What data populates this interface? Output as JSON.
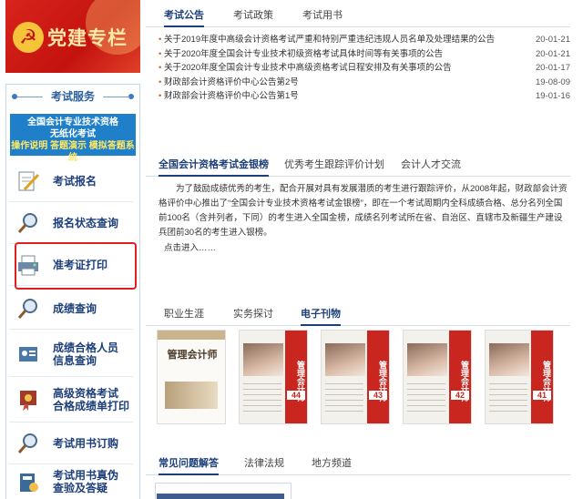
{
  "left": {
    "party_title": "党建专栏",
    "service_title": "考试服务",
    "banner": {
      "line1": "全国会计专业技术资格",
      "line2": "无纸化考试",
      "line3": "操作说明 答题演示 模拟答题系统"
    },
    "items": [
      {
        "label": "考试报名",
        "icon": "pen-paper-icon"
      },
      {
        "label": "报名状态查询",
        "icon": "magnifier-icon"
      },
      {
        "label": "准考证打印",
        "icon": "printer-icon"
      },
      {
        "label": "成绩查询",
        "icon": "magnifier-icon"
      },
      {
        "label": "成绩合格人员信息查询",
        "line1": "成绩合格人员",
        "line2": "信息查询",
        "icon": "person-card-icon"
      },
      {
        "label": "高级资格考试合格成绩单打印",
        "line1": "高级资格考试",
        "line2": "合格成绩单打印",
        "icon": "ribbon-certificate-icon"
      },
      {
        "label": "考试用书订购",
        "icon": "magnifier-icon"
      },
      {
        "label": "考试用书真伪查验及答疑",
        "line1": "考试用书真伪",
        "line2": "查验及答疑",
        "icon": "book-check-icon"
      }
    ]
  },
  "top_tabs": [
    "考试公告",
    "考试政策",
    "考试用书"
  ],
  "news": [
    {
      "title": "关于2019年度中高级会计资格考试严重和特别严重违纪违规人员名单及处理结果的公告",
      "date": "20-01-21"
    },
    {
      "title": "关于2020年度全国会计专业技术初级资格考试具体时间等有关事项的公告",
      "date": "20-01-21"
    },
    {
      "title": "关于2020年度全国会计专业技术中高级资格考试日程安排及有关事项的公告",
      "date": "20-01-17"
    },
    {
      "title": "财政部会计资格评价中心公告第2号",
      "date": "19-08-09"
    },
    {
      "title": "财政部会计资格评价中心公告第1号",
      "date": "19-01-16"
    }
  ],
  "mid_tabs": [
    "全国会计资格考试金银榜",
    "优秀考生跟踪评价计划",
    "会计人才交流"
  ],
  "paragraph": "为了鼓励成绩优秀的考生，配合开展对具有发展潜质的考生进行跟踪评价，从2008年起，财政部会计资格评价中心推出了“全国会计专业技术资格考试金银榜”，即在一个考试周期内全科成绩合格、总分名列全国前100名（含并列者，下同）的考生进入全国金榜，成绩名列考试所在省、自治区、直辖市及新疆生产建设兵团前30名的考生进入银榜。",
  "more_link": "点击进入……",
  "lower_tabs": [
    "职业生涯",
    "实务探讨",
    "电子刊物"
  ],
  "magazines": [
    {
      "title": "管理会计师",
      "num": ""
    },
    {
      "title": "管理会计师",
      "num": "44"
    },
    {
      "title": "管理会计师",
      "num": "43"
    },
    {
      "title": "管理会计师",
      "num": "42"
    },
    {
      "title": "管理会计师",
      "num": "41"
    },
    {
      "title": "管理会计师",
      "num": "40"
    }
  ],
  "bottom_tabs": [
    "常见问题解答",
    "法律法规",
    "地方频道"
  ]
}
